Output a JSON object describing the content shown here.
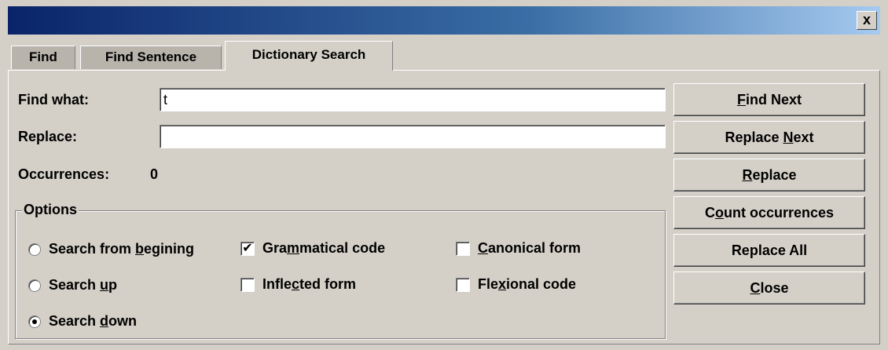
{
  "window": {
    "close_label": "x"
  },
  "tabs": [
    {
      "label": "Find",
      "active": false
    },
    {
      "label": "Find Sentence",
      "active": false
    },
    {
      "label": "Dictionary Search",
      "active": true
    }
  ],
  "form": {
    "find_label": "Find what:",
    "find_value": "t",
    "replace_label": "Replace:",
    "replace_value": "",
    "occurrences_label": "Occurrences:",
    "occurrences_value": "0"
  },
  "options": {
    "legend": "Options",
    "radios": [
      {
        "pre": "Search from ",
        "mn": "b",
        "post": "egining",
        "checked": false
      },
      {
        "pre": "Search ",
        "mn": "u",
        "post": "p",
        "checked": false
      },
      {
        "pre": "Search ",
        "mn": "d",
        "post": "own",
        "checked": true
      }
    ],
    "checks": [
      {
        "pre": "Gra",
        "mn": "m",
        "post": "matical code",
        "checked": true
      },
      {
        "pre": "Infle",
        "mn": "c",
        "post": "ted form",
        "checked": false
      },
      {
        "pre": "",
        "mn": "C",
        "post": "anonical form",
        "checked": false
      },
      {
        "pre": "Fle",
        "mn": "x",
        "post": "ional code",
        "checked": false
      }
    ]
  },
  "buttons": [
    {
      "pre": "",
      "mn": "F",
      "post": "ind Next"
    },
    {
      "pre": "Replace ",
      "mn": "N",
      "post": "ext"
    },
    {
      "pre": "",
      "mn": "R",
      "post": "eplace"
    },
    {
      "pre": "C",
      "mn": "o",
      "post": "unt occurrences"
    },
    {
      "pre": "Replace All",
      "mn": "",
      "post": ""
    },
    {
      "pre": "",
      "mn": "C",
      "post": "lose"
    }
  ]
}
